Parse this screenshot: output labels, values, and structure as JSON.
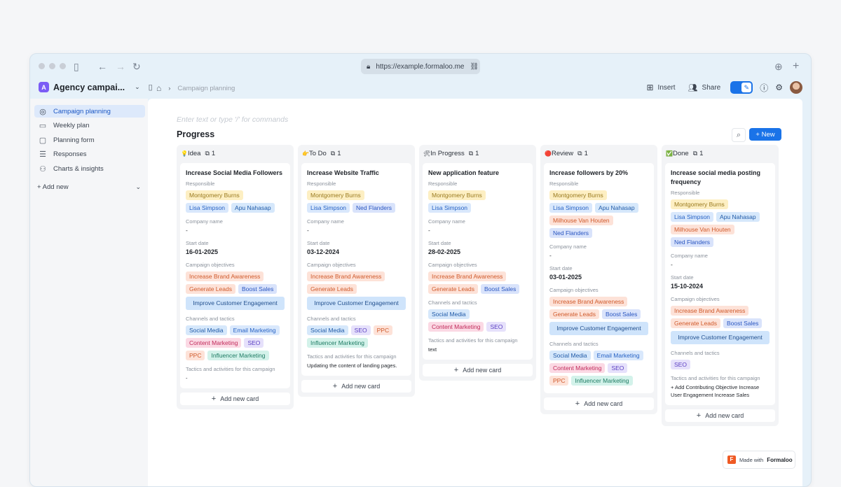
{
  "browser": {
    "url": "https://example.formaloo.me",
    "icons": [
      "sidebar-icon",
      "back-icon",
      "forward-icon",
      "reload-icon",
      "lock-icon",
      "link-icon",
      "download-icon",
      "new-tab-icon"
    ]
  },
  "app": {
    "workspace_initial": "A",
    "workspace_name": "Agency campai...",
    "breadcrumb": [
      "Campaign planning"
    ],
    "insert_label": "Insert",
    "share_label": "Share"
  },
  "sidebar": {
    "items": [
      {
        "label": "Campaign planning",
        "icon": "target-icon",
        "active": true
      },
      {
        "label": "Weekly plan",
        "icon": "board-icon",
        "active": false
      },
      {
        "label": "Planning form",
        "icon": "form-icon",
        "active": false
      },
      {
        "label": "Responses",
        "icon": "list-icon",
        "active": false
      },
      {
        "label": "Charts & insights",
        "icon": "chart-icon",
        "active": false
      }
    ],
    "add_new": "+ Add new"
  },
  "main": {
    "placeholder": "Enter text or type '/' for commands",
    "title": "Progress",
    "new_button": "+ New",
    "add_card_label": "Add new card"
  },
  "labels": {
    "responsible": "Responsible",
    "company": "Company name",
    "start": "Start date",
    "objectives": "Campaign objectives",
    "channels": "Channels and tactics",
    "tactics": "Tactics and activities for this campaign"
  },
  "columns": [
    {
      "emoji": "💡",
      "name": "Idea",
      "count": "1",
      "card": {
        "title": "Increase Social Media Followers",
        "responsible": [
          [
            "Montgomery Burns",
            "t-yellow"
          ],
          [
            "Lisa Simpson",
            "t-blue"
          ],
          [
            "Apu Nahasap",
            "t-lblue"
          ]
        ],
        "company": "-",
        "start": "16-01-2025",
        "objectives": [
          [
            "Increase Brand Awareness",
            "t-orange"
          ],
          [
            "Generate Leads",
            "t-orange"
          ],
          [
            "Boost Sales",
            "t-ind"
          ],
          [
            "Improve Customer Engagement",
            "t-sky wide"
          ]
        ],
        "channels": [
          [
            "Social Media",
            "t-lblue"
          ],
          [
            "Email Marketing",
            "t-blue"
          ],
          [
            "Content Marketing",
            "t-pink"
          ],
          [
            "SEO",
            "t-purple"
          ],
          [
            "PPC",
            "t-orange"
          ],
          [
            "Influencer Marketing",
            "t-teal"
          ]
        ],
        "tactics": "-"
      }
    },
    {
      "emoji": "👉",
      "name": "To Do",
      "count": "1",
      "card": {
        "title": "Increase Website Traffic",
        "responsible": [
          [
            "Montgomery Burns",
            "t-yellow"
          ],
          [
            "Lisa Simpson",
            "t-blue"
          ],
          [
            "Ned Flanders",
            "t-ind"
          ]
        ],
        "company": "-",
        "start": "03-12-2024",
        "objectives": [
          [
            "Increase Brand Awareness",
            "t-orange"
          ],
          [
            "Generate Leads",
            "t-orange"
          ],
          [
            "Improve Customer Engagement",
            "t-sky wide"
          ]
        ],
        "channels": [
          [
            "Social Media",
            "t-lblue"
          ],
          [
            "SEO",
            "t-purple"
          ],
          [
            "PPC",
            "t-orange"
          ],
          [
            "Influencer Marketing",
            "t-teal"
          ]
        ],
        "tactics": "Updating the content of landing pages."
      }
    },
    {
      "emoji": "🛠",
      "name": "In Progress",
      "count": "1",
      "card": {
        "title": "New application feature",
        "responsible": [
          [
            "Montgomery Burns",
            "t-yellow"
          ],
          [
            "Lisa Simpson",
            "t-blue"
          ]
        ],
        "company": "-",
        "start": "28-02-2025",
        "objectives": [
          [
            "Increase Brand Awareness",
            "t-orange"
          ],
          [
            "Generate Leads",
            "t-orange"
          ],
          [
            "Boost Sales",
            "t-ind"
          ]
        ],
        "channels": [
          [
            "Social Media",
            "t-lblue"
          ],
          [
            "Content Marketing",
            "t-pink"
          ],
          [
            "SEO",
            "t-purple"
          ]
        ],
        "tactics": "text"
      }
    },
    {
      "emoji": "🔴",
      "name": "Review",
      "count": "1",
      "card": {
        "title": "Increase followers by 20%",
        "responsible": [
          [
            "Montgomery Burns",
            "t-yellow"
          ],
          [
            "Lisa Simpson",
            "t-blue"
          ],
          [
            "Apu Nahasap",
            "t-lblue"
          ],
          [
            "Milhouse Van Houten",
            "t-orange"
          ],
          [
            "Ned Flanders",
            "t-ind"
          ]
        ],
        "company": "-",
        "start": "03-01-2025",
        "objectives": [
          [
            "Increase Brand Awareness",
            "t-orange"
          ],
          [
            "Generate Leads",
            "t-orange"
          ],
          [
            "Boost Sales",
            "t-ind"
          ],
          [
            "Improve Customer Engagement",
            "t-sky wide"
          ]
        ],
        "channels": [
          [
            "Social Media",
            "t-lblue"
          ],
          [
            "Email Marketing",
            "t-blue"
          ],
          [
            "Content Marketing",
            "t-pink"
          ],
          [
            "SEO",
            "t-purple"
          ],
          [
            "PPC",
            "t-orange"
          ],
          [
            "Influencer Marketing",
            "t-teal"
          ]
        ],
        "tactics": null
      }
    },
    {
      "emoji": "✅",
      "name": "Done",
      "count": "1",
      "card": {
        "title": "Increase social media posting frequency",
        "responsible": [
          [
            "Montgomery Burns",
            "t-yellow"
          ],
          [
            "Lisa Simpson",
            "t-blue"
          ],
          [
            "Apu Nahasap",
            "t-lblue"
          ],
          [
            "Milhouse Van Houten",
            "t-orange"
          ],
          [
            "Ned Flanders",
            "t-ind"
          ]
        ],
        "company": "-",
        "start": "15-10-2024",
        "objectives": [
          [
            "Increase Brand Awareness",
            "t-orange"
          ],
          [
            "Generate Leads",
            "t-orange"
          ],
          [
            "Boost Sales",
            "t-ind"
          ],
          [
            "Improve Customer Engagement",
            "t-sky wide"
          ]
        ],
        "channels": [
          [
            "SEO",
            "t-purple"
          ]
        ],
        "tactics": "+ Add Contributing Objective Increase User Engagement Increase Sales"
      }
    }
  ],
  "footer": {
    "made_with": "Made with",
    "brand": "Formaloo",
    "logo_letter": "F"
  },
  "colors": {
    "accent": "#1a73e8",
    "workspace": "#7b5cf5",
    "brand": "#ef5a24"
  }
}
